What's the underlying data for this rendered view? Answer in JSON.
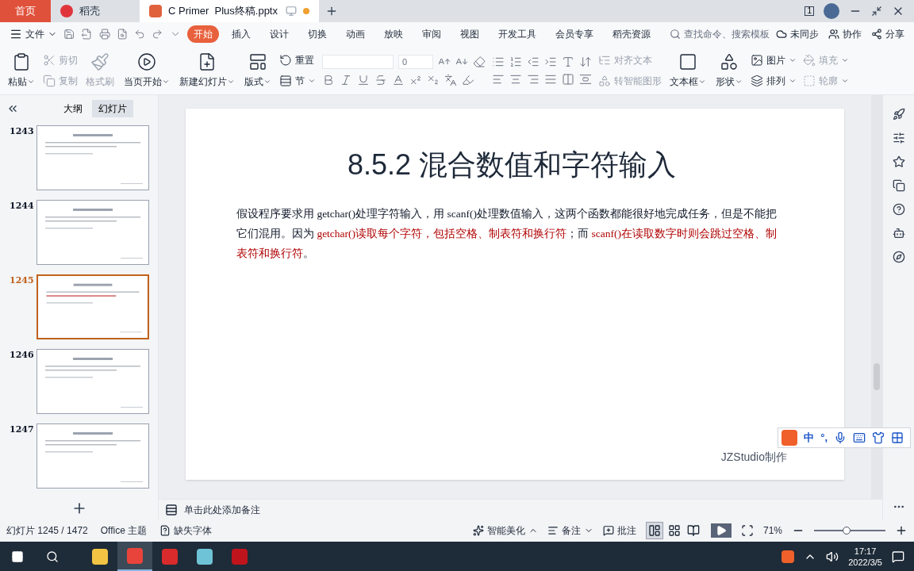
{
  "tabs": [
    {
      "kind": "home",
      "label": "首页",
      "selected": false
    },
    {
      "kind": "docer",
      "label": "稻壳",
      "selected": false
    },
    {
      "kind": "doc",
      "label": "C Primer  Plus终稿.pptx",
      "selected": true,
      "unsaved": true
    }
  ],
  "window_badge": "1",
  "menu": {
    "file": "文件",
    "items": [
      {
        "label": "开始",
        "selected": true
      },
      {
        "label": "插入",
        "selected": false
      },
      {
        "label": "设计",
        "selected": false
      },
      {
        "label": "切换",
        "selected": false
      },
      {
        "label": "动画",
        "selected": false
      },
      {
        "label": "放映",
        "selected": false
      },
      {
        "label": "审阅",
        "selected": false
      },
      {
        "label": "视图",
        "selected": false
      },
      {
        "label": "开发工具",
        "selected": false
      },
      {
        "label": "会员专享",
        "selected": false
      },
      {
        "label": "稻壳资源",
        "selected": false
      }
    ],
    "search": {
      "placeholder": "查找命令、搜索模板"
    },
    "actions": [
      "未同步",
      "协作",
      "分享"
    ]
  },
  "ribbon": {
    "clipboard": [
      {
        "label": "粘贴",
        "dropdown": true,
        "disabled": false
      },
      {
        "label": "剪切",
        "dropdown": false,
        "disabled": true
      },
      {
        "label": "复制",
        "dropdown": false,
        "disabled": true
      },
      {
        "label": "格式刷",
        "dropdown": false,
        "disabled": true
      }
    ],
    "slides": [
      {
        "label": "当页开始",
        "dropdown": true
      },
      {
        "label": "新建幻灯片",
        "dropdown": true
      },
      {
        "label": "版式",
        "dropdown": true
      },
      {
        "label": "重置",
        "dropdown": false
      },
      {
        "label": "节",
        "dropdown": true
      }
    ],
    "font_size": {
      "value": "0"
    },
    "text_tools": [
      {
        "label": "对齐文本",
        "disabled": true
      },
      {
        "label": "转智能图形",
        "disabled": true
      }
    ],
    "insert": [
      {
        "label": "文本框",
        "dropdown": true,
        "disabled": false
      },
      {
        "label": "形状",
        "dropdown": true,
        "disabled": false
      },
      {
        "label": "图片",
        "dropdown": true,
        "disabled": false
      },
      {
        "label": "排列",
        "dropdown": true,
        "disabled": false
      },
      {
        "label": "填充",
        "dropdown": true,
        "disabled": true
      },
      {
        "label": "轮廓",
        "dropdown": true,
        "disabled": true
      }
    ]
  },
  "left_panel": {
    "tabs": [
      {
        "label": "大纲",
        "selected": false
      },
      {
        "label": "幻灯片",
        "selected": true
      }
    ],
    "slides": [
      {
        "number": "1243",
        "selected": false
      },
      {
        "number": "1244",
        "selected": false
      },
      {
        "number": "1245",
        "selected": true
      },
      {
        "number": "1246",
        "selected": false
      },
      {
        "number": "1247",
        "selected": false
      }
    ]
  },
  "slide": {
    "title": "8.5.2 混合数值和字符输入",
    "paragraph": [
      {
        "text": "假设程序要求用 getchar()处理字符输入，用 scanf()处理数值输入，这两个函数都能很好地完成任务，但是不能把它们混用。因为 ",
        "emphasis": false
      },
      {
        "text": "getchar()读取每个字符，包括空格、制表符和换行符",
        "emphasis": true
      },
      {
        "text": "；而 ",
        "emphasis": false
      },
      {
        "text": "scanf()在读取数字时则会跳过空格、制表符和换行符",
        "emphasis": true
      },
      {
        "text": "。",
        "emphasis": false
      }
    ],
    "footer": "JZStudio制作"
  },
  "ime": {
    "mode": "中",
    "punctuation": "°,"
  },
  "notes": {
    "placeholder": "单击此处添加备注"
  },
  "status_bar": {
    "slide_counter": "幻灯片 1245 / 1472",
    "theme": "Office 主题",
    "missing_fonts": "缺失字体",
    "beautify": "智能美化",
    "notes": "备注",
    "comments": "批注",
    "views": [
      {
        "kind": "normal",
        "selected": true
      },
      {
        "kind": "sorter",
        "selected": false
      },
      {
        "kind": "reading",
        "selected": false
      }
    ],
    "zoom": "71%",
    "zoom_slider": {
      "level": 0.45
    }
  },
  "taskbar": {
    "apps": [
      {
        "kind": "folder",
        "selected": false
      },
      {
        "kind": "wps",
        "selected": true
      },
      {
        "kind": "pdf",
        "selected": false
      },
      {
        "kind": "notes",
        "selected": false
      },
      {
        "kind": "recorder",
        "selected": false
      }
    ],
    "time": "17:17",
    "date": "2022/3/5"
  }
}
